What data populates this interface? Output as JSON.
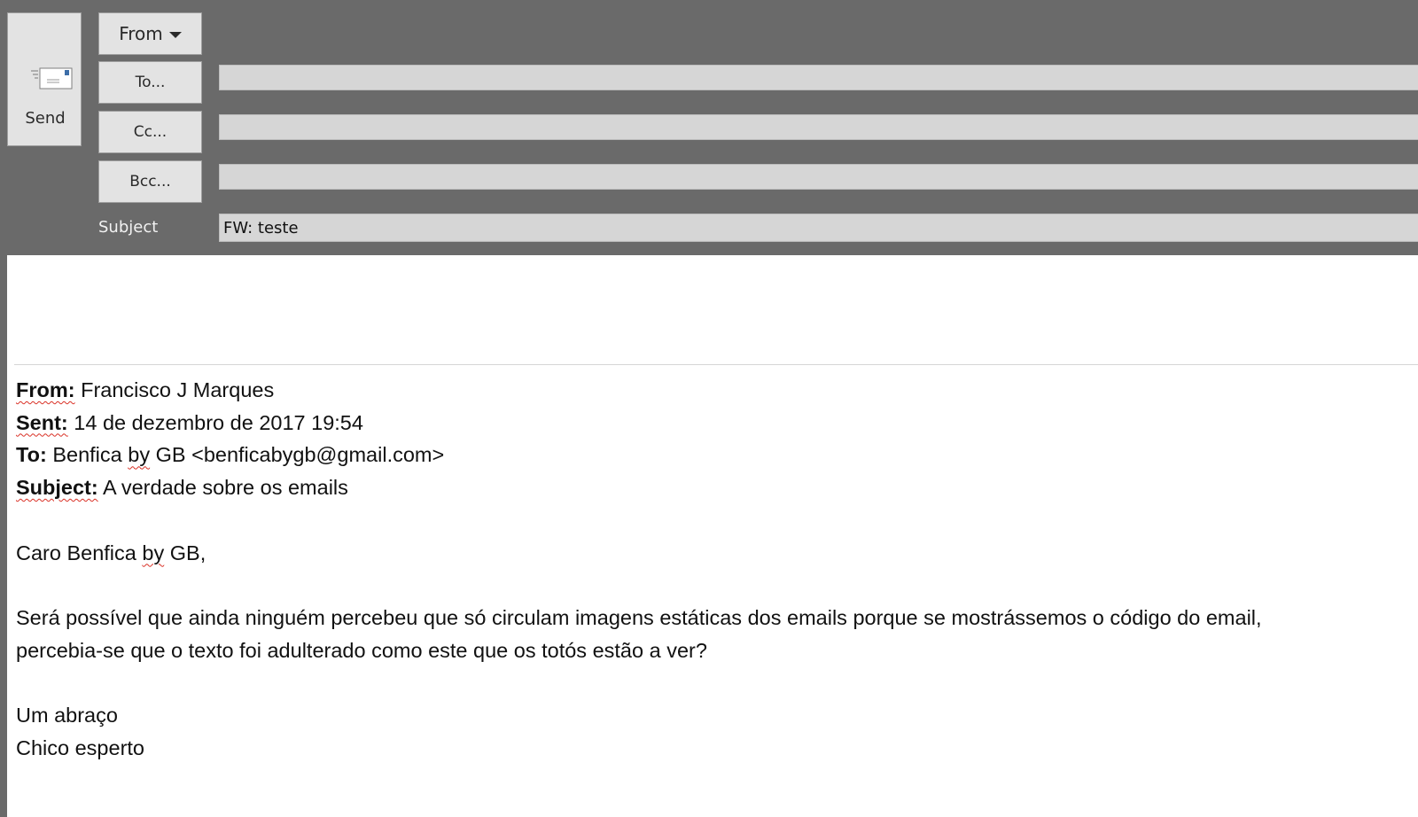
{
  "toolbar": {
    "send_label": "Send",
    "from_label": "From",
    "to_label": "To...",
    "cc_label": "Cc...",
    "bcc_label": "Bcc...",
    "subject_label": "Subject"
  },
  "fields": {
    "to_value": "",
    "cc_value": "",
    "bcc_value": "",
    "subject_value": "FW: teste"
  },
  "message": {
    "from_key": "From:",
    "from_value": "Francisco J Marques",
    "sent_key": "Sent:",
    "sent_value": "14 de dezembro de 2017 19:54",
    "to_key": "To:",
    "to_value_prefix": "Benfica",
    "to_value_by": "by",
    "to_value_rest": "GB <benficabygb@gmail.com>",
    "subject_key": "Subject:",
    "subject_value": "A verdade sobre os emails",
    "greeting_prefix": "Caro Benfica",
    "greeting_by": "by",
    "greeting_rest": "GB,",
    "paragraph_line1": "Será possível que ainda ninguém percebeu que só circulam imagens estáticas dos emails porque se mostrássemos o código do email,",
    "paragraph_line2": "percebia-se que o texto foi adulterado como este que os totós estão a ver?",
    "signoff": "Um abraço",
    "signature": "Chico esperto"
  },
  "colors": {
    "header_bg": "#6a6a6a",
    "button_bg": "#e3e3e3",
    "field_bg": "#d6d6d6",
    "spellcheck": "#d93025"
  },
  "icons": {
    "send": "envelope-icon",
    "from_dropdown": "caret-down-icon"
  }
}
